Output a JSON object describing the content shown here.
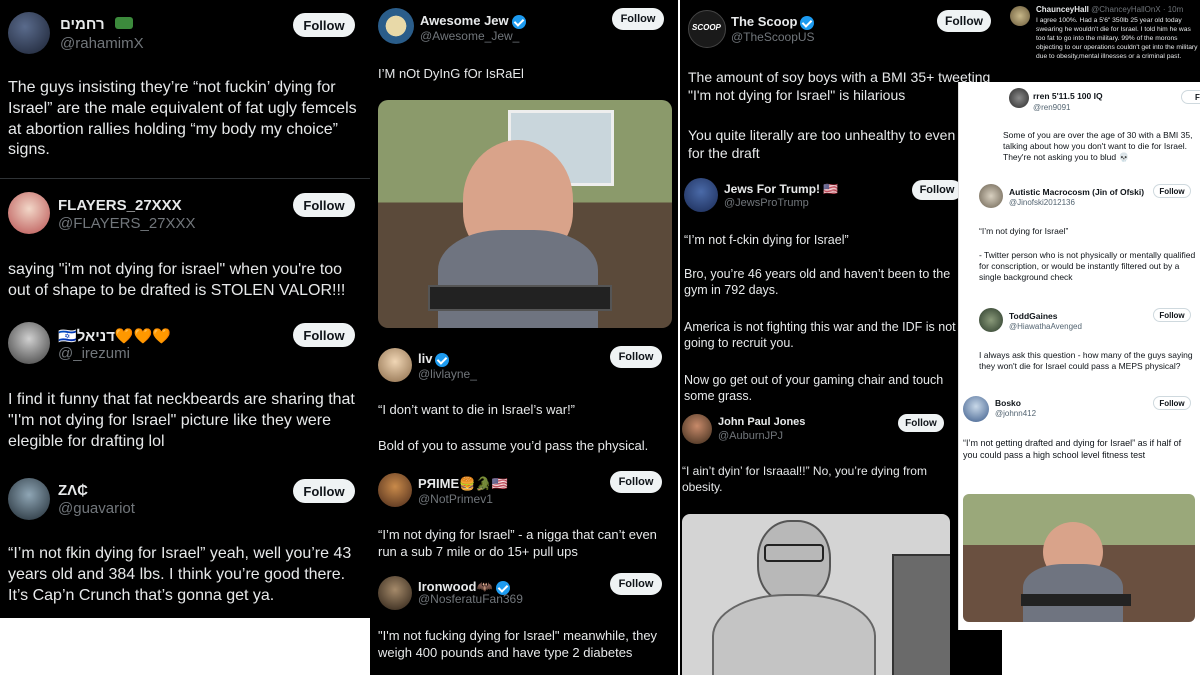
{
  "col1": {
    "tweets": [
      {
        "name": "רחמים",
        "handle": "@rahamimX",
        "follow": "Follow",
        "text": "The guys insisting they’re “not fuckin’ dying for Israel” are the male equivalent of fat ugly femcels at abortion rallies holding “my body my choice” signs."
      },
      {
        "name": "FLAYERS_27XXX",
        "handle": "@FLAYERS_27XXX",
        "follow": "Follow",
        "text": "saying \"i'm not dying for israel\" when you're too out of shape to be drafted is STOLEN VALOR!!!"
      },
      {
        "name": "🇮🇱דניאל🧡🧡🧡",
        "handle": "@_irezumi",
        "follow": "Follow",
        "text": "I find it funny that fat neckbeards are sharing that \"I'm not dying for Israel\" picture like they were elegible for drafting lol"
      },
      {
        "name": "ZΛ₵",
        "handle": "@guavariot",
        "follow": "Follow",
        "text": "“I’m not fkin dying for Israel” yeah, well you’re 43 years old and 384 lbs. I think you’re good there. It’s Cap’n Crunch that’s gonna get ya."
      }
    ]
  },
  "col2": {
    "t1": {
      "name": "Awesome Jew",
      "handle": "@Awesome_Jew_",
      "follow": "Follow",
      "text": "I’M nOt DyInG fOr IsRaEl"
    },
    "t2": {
      "name": "liv",
      "handle": "@livlayne_",
      "follow": "Follow",
      "text1": "“I don’t want to die in Israel’s war!”",
      "text2": "Bold of you to assume you’d pass the physical."
    },
    "t3": {
      "name": "PЯIME🍔🐊🇺🇸",
      "handle": "@NotPrimev1",
      "follow": "Follow",
      "text": "“I’m not dying for Israel” - a nigga that can’t even run a sub 7 mile or do 15+ pull ups"
    },
    "t4": {
      "name": "Ironwood🦇",
      "handle": "@NosferatuFan369",
      "follow": "Follow",
      "text": "\"I'm not fucking dying for Israel\" meanwhile, they weigh 400 pounds and have type 2 diabetes"
    }
  },
  "col3": {
    "t1": {
      "avatar": "SCOOP",
      "name": "The Scoop",
      "handle": "@TheScoopUS",
      "follow": "Follow",
      "text1": "The amount of soy boys with a BMI 35+ tweeting \"I'm not dying for Israel\" is hilarious",
      "text2": "You quite literally are too unhealthy to even qualify for the draft"
    },
    "t2": {
      "name": "Jews For Trump! 🇺🇸",
      "handle": "@JewsProTrump",
      "follow": "Follow",
      "text1": "“I’m not f-ckin dying for Israel”",
      "text2": "Bro, you’re 46 years old and haven’t been to the gym in 792 days.",
      "text3": "America is not fighting this war and the IDF is not going to recruit you.",
      "text4": "Now go get out of your gaming chair and touch some grass."
    },
    "t3": {
      "name": "John Paul Jones",
      "handle": "@AuburnJPJ",
      "follow": "Follow",
      "text": "“I ain’t dyin’ for Israaal!!” No, you’re dying from obesity."
    }
  },
  "col4": {
    "t0": {
      "name": "ChaunceyHall",
      "handle": "@ChanceyHallOnX · 10m",
      "text": "I agree 100%.  Had a 5'6\" 350lb 25 year old today swearing he wouldn't die for Israel.  I told him he was too fat to go into the military.  99% of the morons objecting to our operations couldn't get into the military due to obesity,mental illnesses or a criminal past."
    },
    "t1": {
      "name": "rren 5'11.5 100 IQ",
      "handle": "@ren9091",
      "follow": "Fol",
      "text": "Some of you are over the age of 30 with a BMI 35, talking about how you don't want to die for Israel.  They're not asking you to blud 💀"
    },
    "t2": {
      "name": "Autistic Macrocosm (Jin of Ofski)",
      "handle": "@Jinofski2012136",
      "follow": "Follow",
      "text1": "“I’m not dying for Israel”",
      "text2": "- Twitter person who is not physically or mentally qualified for conscription, or would be instantly filtered out by a single background check"
    },
    "t3": {
      "name": "ToddGaines",
      "handle": "@HiawathaAvenged",
      "follow": "Follow",
      "text": "I always ask this question - how many of the guys saying they won't die for Israel could pass a MEPS physical?"
    },
    "t4": {
      "name": "Bosko",
      "handle": "@johnn412",
      "follow": "Follow",
      "text": "“I’m not getting drafted and dying for Israel” as if half of you could pass a high school level fitness test"
    }
  },
  "colors": {
    "dark": "#000000",
    "verified": "#1d9bf0"
  }
}
